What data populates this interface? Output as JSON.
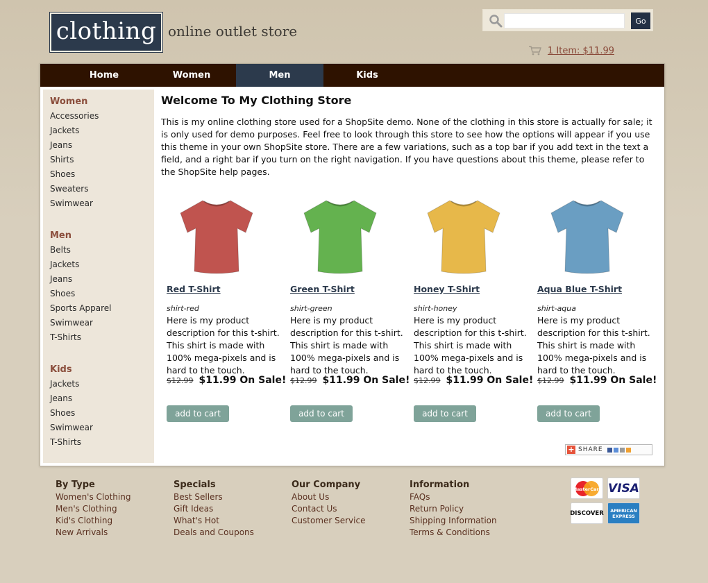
{
  "header": {
    "logo_text": "clothing",
    "tagline": "online outlet store",
    "search_placeholder": "",
    "search_button": "Go",
    "cart_label": "1 Item: $11.99"
  },
  "nav": {
    "items": [
      {
        "label": "Home"
      },
      {
        "label": "Women"
      },
      {
        "label": "Men",
        "active": true
      },
      {
        "label": "Kids"
      }
    ]
  },
  "sidebar": {
    "groups": [
      {
        "heading": "Women",
        "links": [
          "Accessories",
          "Jackets",
          "Jeans",
          "Shirts",
          "Shoes",
          "Sweaters",
          "Swimwear"
        ]
      },
      {
        "heading": "Men",
        "links": [
          "Belts",
          "Jackets",
          "Jeans",
          "Shoes",
          "Sports Apparel",
          "Swimwear",
          "T-Shirts"
        ]
      },
      {
        "heading": "Kids",
        "links": [
          "Jackets",
          "Jeans",
          "Shoes",
          "Swimwear",
          "T-Shirts"
        ]
      }
    ]
  },
  "main": {
    "title": "Welcome To My Clothing Store",
    "intro": "This is my online clothing store used for a ShopSite demo. None of the clothing in this store is actually for sale; it is only used for demo purposes. Feel free to look through this store to see how the options will appear if you use this theme in your own ShopSite store. There are a few variations, such as a top bar if you add text in the text a field, and a right bar if you turn on the right navigation. If you have questions about this theme, please refer to the ShopSite help pages.",
    "products": [
      {
        "name": "Red T-Shirt",
        "sku": "shirt-red",
        "color": "#c0544f",
        "description": "Here is my product description for this t-shirt. This shirt is made with 100% mega-pixels and is hard to the touch.",
        "old_price": "$12.99",
        "sale_price": "$11.99 On Sale!",
        "button": "add to cart"
      },
      {
        "name": "Green T-Shirt",
        "sku": "shirt-green",
        "color": "#64b24f",
        "description": "Here is my product description for this t-shirt. This shirt is made with 100% mega-pixels and is hard to the touch.",
        "old_price": "$12.99",
        "sale_price": "$11.99 On Sale!",
        "button": "add to cart"
      },
      {
        "name": "Honey T-Shirt",
        "sku": "shirt-honey",
        "color": "#e7b84a",
        "description": "Here is my product description for this t-shirt. This shirt is made with 100% mega-pixels and is hard to the touch.",
        "old_price": "$12.99",
        "sale_price": "$11.99 On Sale!",
        "button": "add to cart"
      },
      {
        "name": "Aqua Blue T-Shirt",
        "sku": "shirt-aqua",
        "color": "#6a9ec2",
        "description": "Here is my product description for this t-shirt. This shirt is made with 100% mega-pixels and is hard to the touch.",
        "old_price": "$12.99",
        "sale_price": "$11.99 On Sale!",
        "button": "add to cart"
      }
    ],
    "share_label": "SHARE"
  },
  "footer": {
    "columns": [
      {
        "heading": "By Type",
        "links": [
          "Women's Clothing",
          "Men's Clothing",
          "Kid's Clothing",
          "New Arrivals"
        ]
      },
      {
        "heading": "Specials",
        "links": [
          "Best Sellers",
          "Gift Ideas",
          "What's Hot",
          "Deals and Coupons"
        ]
      },
      {
        "heading": "Our Company",
        "links": [
          "About Us",
          "Contact Us",
          "Customer Service"
        ]
      },
      {
        "heading": "Information",
        "links": [
          "FAQs",
          "Return Policy",
          "Shipping Information",
          "Terms & Conditions"
        ]
      }
    ],
    "cards": [
      "MasterCard",
      "VISA",
      "DISCOVER",
      "AMERICAN EXPRESS"
    ]
  },
  "colors": {
    "nav_bg": "#2e1200",
    "nav_active": "#2c3a4c",
    "sidebar_bg": "#ede6da",
    "sidebar_heading": "#8b4e3c",
    "button": "#7fa399",
    "page_bg": "#d8cfbd"
  }
}
